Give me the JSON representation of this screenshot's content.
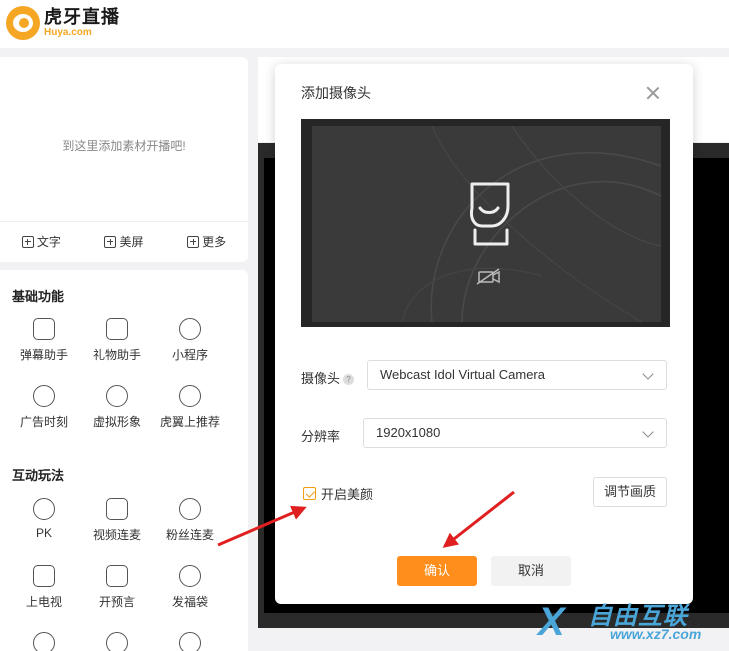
{
  "header": {
    "logo_cn": "虎牙直播",
    "logo_en": "Huya.com"
  },
  "material": {
    "empty_text": "到这里添加素材开播吧!",
    "actions": [
      {
        "label": "文字"
      },
      {
        "label": "美屏"
      },
      {
        "label": "更多"
      }
    ]
  },
  "basic": {
    "title": "基础功能",
    "items": [
      {
        "label": "弹幕助手",
        "icon": "danmaku-icon"
      },
      {
        "label": "礼物助手",
        "icon": "gift-icon"
      },
      {
        "label": "小程序",
        "icon": "mini-program-icon"
      },
      {
        "label": "广告时刻",
        "icon": "ad-icon"
      },
      {
        "label": "虚拟形象",
        "icon": "avatar-icon"
      },
      {
        "label": "虎翼上推荐",
        "icon": "recommend-icon"
      }
    ]
  },
  "interactive": {
    "title": "互动玩法",
    "items": [
      {
        "label": "PK",
        "icon": "pk-icon"
      },
      {
        "label": "视频连麦",
        "icon": "video-link-icon"
      },
      {
        "label": "粉丝连麦",
        "icon": "mic-icon"
      },
      {
        "label": "上电视",
        "icon": "tv-icon"
      },
      {
        "label": "开预言",
        "icon": "trophy-icon"
      },
      {
        "label": "发福袋",
        "icon": "lucky-bag-icon"
      }
    ]
  },
  "modal": {
    "title": "添加摄像头",
    "camera_label": "摄像头",
    "help": "?",
    "camera_value": "Webcast Idol Virtual Camera",
    "resolution_label": "分辨率",
    "resolution_value": "1920x1080",
    "beauty_label": "开启美颜",
    "beauty_checked": true,
    "quality_button": "调节画质",
    "confirm": "确认",
    "cancel": "取消"
  },
  "watermark": {
    "title": "自由互联",
    "url": "www.xz7.com",
    "mark": "X"
  },
  "colors": {
    "accent": "#ff8e1c",
    "arrow": "#e02020",
    "watermark": "#4aa5d8"
  }
}
